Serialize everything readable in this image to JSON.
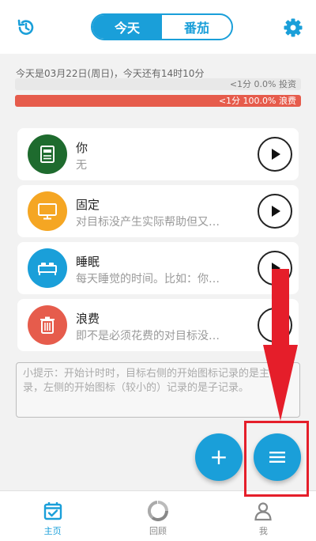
{
  "colors": {
    "accent": "#1a9fd9",
    "waste": "#e65c4c",
    "annotation": "#e51e2a",
    "cat_you": "#1e6b2e",
    "cat_fixed": "#f5a623",
    "cat_sleep": "#1a9fd9",
    "cat_waste": "#e65c4c"
  },
  "header": {
    "history_icon": "history-icon",
    "settings_icon": "gear-icon",
    "tabs": [
      {
        "label": "今天",
        "active": true
      },
      {
        "label": "番茄",
        "active": false
      }
    ]
  },
  "summary": {
    "date_text": "今天是03月22日(周日)，今天还有14时10分",
    "invest_text": "<1分 0.0% 投资",
    "invest_fraction": 0.0,
    "waste_text": "<1分 100.0% 浪费",
    "waste_fraction": 1.0
  },
  "categories": [
    {
      "title": "你",
      "desc": "无",
      "icon": "notebook-icon"
    },
    {
      "title": "固定",
      "desc": "对目标没产生实际帮助但又…",
      "icon": "monitor-icon"
    },
    {
      "title": "睡眠",
      "desc": "每天睡觉的时间。比如：你…",
      "icon": "bed-icon"
    },
    {
      "title": "浪费",
      "desc": "即不是必须花费的对目标没…",
      "icon": "trash-icon"
    }
  ],
  "tip": {
    "text": "小提示：开始计时时，目标右侧的开始图标记录的是主记录，左侧的开始图标（较小的）记录的是子记录。"
  },
  "fab": {
    "add_label": "+",
    "menu_icon": "menu-icon"
  },
  "nav": [
    {
      "label": "主页",
      "icon": "calendar-check-icon",
      "active": true
    },
    {
      "label": "回顾",
      "icon": "ring-chart-icon",
      "active": false
    },
    {
      "label": "我",
      "icon": "person-icon",
      "active": false
    }
  ]
}
